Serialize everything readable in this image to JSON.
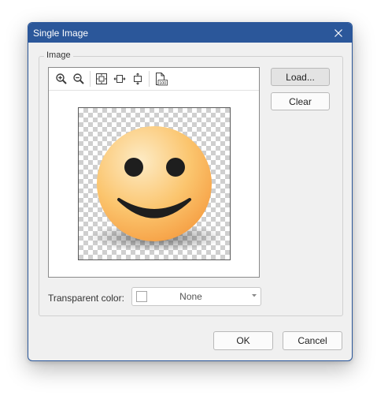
{
  "window": {
    "title": "Single Image"
  },
  "group": {
    "label": "Image"
  },
  "toolbar": {
    "buttons": [
      {
        "name": "zoom-in",
        "icon": "zoom-in-icon"
      },
      {
        "name": "zoom-out",
        "icon": "zoom-out-icon"
      },
      {
        "name": "fit-to-window",
        "icon": "fit-window-icon"
      },
      {
        "name": "fit-width",
        "icon": "fit-width-icon"
      },
      {
        "name": "fit-height",
        "icon": "fit-height-icon"
      },
      {
        "name": "actual-size",
        "icon": "actual-size-100-icon"
      }
    ],
    "actual_size_label": "100"
  },
  "buttons": {
    "load": "Load...",
    "clear": "Clear",
    "ok": "OK",
    "cancel": "Cancel"
  },
  "transparent_color": {
    "label": "Transparent color:",
    "value": "None"
  },
  "colors": {
    "accent": "#2b579a",
    "dialog_background": "#f0f0f0",
    "smiley_face": "#f8b54a",
    "smiley_features": "#1e1e1e"
  }
}
